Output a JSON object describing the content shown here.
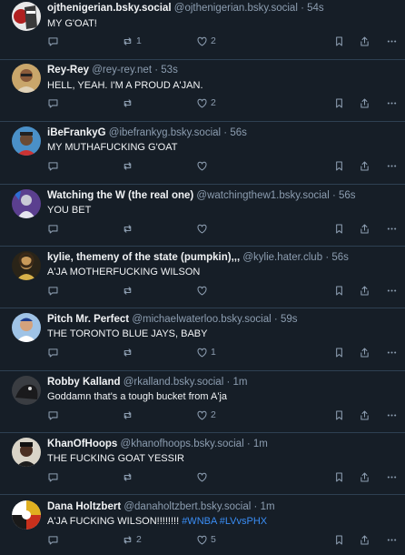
{
  "posts": [
    {
      "display_name": "ojthenigerian.bsky.social",
      "handle": "@ojthenigerian.bsky.social",
      "time": "54s",
      "text": "MY G'OAT!",
      "tags": "",
      "replies": "",
      "reposts": "1",
      "likes": "2",
      "avatar": "avatar-1"
    },
    {
      "display_name": "Rey-Rey",
      "handle": "@rey-rey.net",
      "time": "53s",
      "text": "HELL, YEAH. I'M A PROUD A'JAN.",
      "tags": "",
      "replies": "",
      "reposts": "",
      "likes": "2",
      "avatar": "avatar-2"
    },
    {
      "display_name": "iBeFrankyG",
      "handle": "@ibefrankyg.bsky.social",
      "time": "56s",
      "text": "MY MUTHAFUCKING G'OAT",
      "tags": "",
      "replies": "",
      "reposts": "",
      "likes": "",
      "avatar": "avatar-3"
    },
    {
      "display_name": "Watching the W (the real one)",
      "handle": "@watchingthew1.bsky.social",
      "time": "56s",
      "text": "YOU BET",
      "tags": "",
      "replies": "",
      "reposts": "",
      "likes": "",
      "avatar": "avatar-4"
    },
    {
      "display_name": "kylie, themeny of the state (pumpkin),,,",
      "handle": "@kylie.hater.club",
      "time": "56s",
      "text": "A'JA MOTHERFUCKING WILSON",
      "tags": "",
      "replies": "",
      "reposts": "",
      "likes": "",
      "avatar": "avatar-5"
    },
    {
      "display_name": "Pitch Mr. Perfect",
      "handle": "@michaelwaterloo.bsky.social",
      "time": "59s",
      "text": "THE TORONTO BLUE JAYS, BABY",
      "tags": "",
      "replies": "",
      "reposts": "",
      "likes": "1",
      "avatar": "avatar-6"
    },
    {
      "display_name": "Robby Kalland",
      "handle": "@rkalland.bsky.social",
      "time": "1m",
      "text": "Goddamn that's a tough bucket from A'ja",
      "tags": "",
      "replies": "",
      "reposts": "",
      "likes": "2",
      "avatar": "avatar-7"
    },
    {
      "display_name": "KhanOfHoops",
      "handle": "@khanofhoops.bsky.social",
      "time": "1m",
      "text": "THE FUCKING GOAT YESSIR",
      "tags": "",
      "replies": "",
      "reposts": "",
      "likes": "",
      "avatar": "avatar-8"
    },
    {
      "display_name": "Dana Holtzbert",
      "handle": "@danaholtzbert.bsky.social",
      "time": "1m",
      "text": "A'JA FUCKING WILSON!!!!!!!!",
      "tags": "#WNBA #LVvsPHX",
      "replies": "",
      "reposts": "2",
      "likes": "5",
      "avatar": "avatar-9"
    }
  ],
  "separator": "·",
  "icons": {
    "reply": "reply-icon",
    "repost": "repost-icon",
    "like": "heart-icon",
    "bookmark": "bookmark-icon",
    "share": "share-icon",
    "more": "more-icon"
  },
  "colors": {
    "background": "#161e27",
    "text": "#f1f3f5",
    "muted": "#8c9db0",
    "link": "#3a8ef6",
    "divider": "#2e4052"
  }
}
